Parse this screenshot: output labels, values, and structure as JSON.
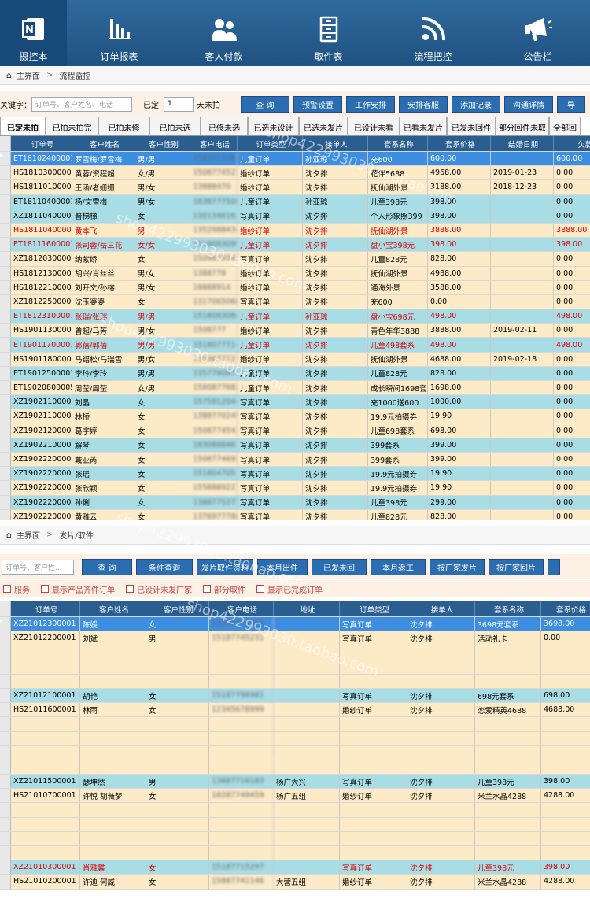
{
  "nav": [
    {
      "label": "摄控本",
      "icon": "onenote-icon"
    },
    {
      "label": "订单报表",
      "icon": "bar-chart-icon"
    },
    {
      "label": "客人付款",
      "icon": "users-icon"
    },
    {
      "label": "取件表",
      "icon": "cabinet-icon"
    },
    {
      "label": "流程把控",
      "icon": "signal-icon"
    },
    {
      "label": "公告栏",
      "icon": "megaphone-icon"
    }
  ],
  "bc1": {
    "home": "主界面",
    "sep": ">",
    "current": "流程监控"
  },
  "tb1": {
    "keyword_label": "关键字：",
    "keyword_placeholder": "订单号、客户姓名、电话",
    "fixed_label": "已定",
    "fixed_value": "1",
    "unshot_label": "天未拍",
    "buttons": [
      "查 询",
      "预警设置",
      "工作安排",
      "安排客服",
      "添加记录",
      "沟通详情",
      "导"
    ]
  },
  "tabs": [
    "已定未拍",
    "已拍未拍完",
    "已拍未修",
    "已拍未选",
    "已修未选",
    "已选未设计",
    "已选未发片",
    "已设计未看",
    "已看未发片",
    "已发未回件",
    "部分回件未取",
    "全部回"
  ],
  "grid1": {
    "headers": [
      "订单号",
      "客户姓名",
      "客户性别",
      "客户电话",
      "订单类型",
      "接单人",
      "套系名称",
      "套系价格",
      "结婚日期",
      "欠款"
    ],
    "rows": [
      {
        "s": "sel",
        "c": [
          "ET18102400001",
          "罗雪梅/罗雪梅",
          "男/男",
          "15825133821",
          "儿童订单",
          "孙亚琼",
          "充600",
          "600.00",
          "",
          "600.00"
        ]
      },
      {
        "s": "cream",
        "c": [
          "HS18103000001",
          "黄蓉/资程超",
          "女/男",
          "15087745231",
          "婚纱订单",
          "沈夕排",
          "花伴5688",
          "4968.00",
          "2019-01-23",
          "0.00"
        ]
      },
      {
        "s": "cream",
        "c": [
          "HS18110100001",
          "王函/者姗姗",
          "男/女",
          "13888470",
          "婚纱订单",
          "沈夕排",
          "抚仙湖外景",
          "3188.00",
          "2018-12-23",
          "0.00"
        ]
      },
      {
        "s": "blue",
        "c": [
          "ET18110400001",
          "杨/文雪梅",
          "男/女",
          "18387775080",
          "儿童订单",
          "孙亚琼",
          "儿童398元",
          "398.00",
          "",
          "0.00"
        ]
      },
      {
        "s": "blue",
        "c": [
          "XZ18110400002",
          "普梯梯",
          "女",
          "13013461636",
          "写真订单",
          "沈夕排",
          "个人形象照399",
          "398.00",
          "",
          "0.00"
        ]
      },
      {
        "s": "cream red",
        "c": [
          "HS18110400003",
          "黄本飞",
          "男",
          "13529884342",
          "婚纱订单",
          "沈夕排",
          "抚仙湖外景",
          "3888.00",
          "",
          "3888.00"
        ]
      },
      {
        "s": "blue red",
        "c": [
          "ET18111600001",
          "张司蓉/岳三花",
          "女/女",
          "15180830958",
          "儿童订单",
          "沈夕排",
          "盘小宝398元",
          "398.00",
          "",
          "398.00"
        ]
      },
      {
        "s": "cream",
        "c": [
          "XZ18120300001",
          "纳紫娇",
          "女",
          "15098765432",
          "写真订单",
          "沈夕排",
          "儿童828元",
          "828.00",
          "",
          "0.00"
        ]
      },
      {
        "s": "cream",
        "c": [
          "HS18121300001",
          "胡兴/肖丝丝",
          "男/女",
          "1388778",
          "婚纱订单",
          "沈夕排",
          "抚仙湖外景",
          "4988.00",
          "",
          "0.00"
        ]
      },
      {
        "s": "cream",
        "c": [
          "HS18122100001",
          "刘开文/孙榕",
          "男/女",
          "18888914",
          "婚纱订单",
          "沈夕排",
          "通海外景",
          "3588.00",
          "",
          "0.00"
        ]
      },
      {
        "s": "cream",
        "c": [
          "XZ18122500001",
          "沈玉婆婆",
          "女",
          "13170650686",
          "写真订单",
          "沈夕排",
          "充600",
          "0.00",
          "",
          "0.00"
        ]
      },
      {
        "s": "blue red",
        "c": [
          "ET18123100001",
          "张瑞/张瑞",
          "男/男",
          "15180830840",
          "儿童订单",
          "孙亚琼",
          "盘小宝698元",
          "498.00",
          "",
          "498.00"
        ]
      },
      {
        "s": "cream",
        "c": [
          "HS19011300001",
          "曾超/马芳",
          "男/女",
          "1508777",
          "婚纱订单",
          "沈夕排",
          "青色年华3888",
          "3888.00",
          "2019-02-11",
          "0.00"
        ]
      },
      {
        "s": "blue red",
        "c": [
          "ET19011700001",
          "郭蓓/郭蓓",
          "男/男",
          "15180777141",
          "儿童订单",
          "沈夕排",
          "儿童498套系",
          "498.00",
          "",
          "498.00"
        ]
      },
      {
        "s": "cream",
        "c": [
          "HS19011800001",
          "马绍松/马瑞雪",
          "男/女",
          "13508777214",
          "婚纱订单",
          "沈夕排",
          "抚仙湖外景",
          "4688.00",
          "2019-02-18",
          "0.00"
        ]
      },
      {
        "s": "blue",
        "c": [
          "ET19012500001",
          "李玲/李玲",
          "男/男",
          "13577809758",
          "儿童订单",
          "沈夕排",
          "儿童828元",
          "828.00",
          "",
          "0.00"
        ]
      },
      {
        "s": "cream",
        "c": [
          "ET19020800005",
          "周莹/周莹",
          "女/男",
          "15808776824",
          "儿童订单",
          "沈夕排",
          "成长瞬间1698套系",
          "1698.00",
          "",
          "0.00"
        ]
      },
      {
        "s": "blue",
        "c": [
          "XZ19021100001",
          "刘晶",
          "女",
          "15758120442",
          "写真订单",
          "沈夕排",
          "充1000送600",
          "1000.00",
          "",
          "0.00"
        ]
      },
      {
        "s": "cream",
        "c": [
          "XZ19021100002",
          "林桥",
          "女",
          "13887702496",
          "写真订单",
          "沈夕排",
          "19.9元拍摄券",
          "19.90",
          "",
          "0.00"
        ]
      },
      {
        "s": "cream",
        "c": [
          "XZ19021200001",
          "葛宇婷",
          "女",
          "15087745439",
          "写真订单",
          "沈夕排",
          "儿童698套系",
          "698.00",
          "",
          "0.00"
        ]
      },
      {
        "s": "blue",
        "c": [
          "XZ19022100001",
          "解琴",
          "女",
          "18308884615",
          "写真订单",
          "沈夕排",
          "399套系",
          "399.00",
          "",
          "0.00"
        ]
      },
      {
        "s": "cream",
        "c": [
          "XZ19022200001",
          "戴亚芮",
          "女",
          "15087746929",
          "写真订单",
          "沈夕排",
          "399套系",
          "399.00",
          "",
          "0.00"
        ]
      },
      {
        "s": "blue",
        "c": [
          "XZ19022200002",
          "张瑶",
          "女",
          "15180470539",
          "写真订单",
          "沈夕排",
          "19.9元拍摄券",
          "19.90",
          "",
          "0.00"
        ]
      },
      {
        "s": "cream",
        "c": [
          "XZ19022200003",
          "张欣颖",
          "女",
          "15588892279",
          "写真订单",
          "沈夕排",
          "19.9元拍摄券",
          "19.90",
          "",
          "0.00"
        ]
      },
      {
        "s": "blue",
        "c": [
          "XZ19022200004",
          "孙俐",
          "女",
          "13887753727",
          "写真订单",
          "沈夕排",
          "儿童398元",
          "299.00",
          "",
          "0.00"
        ]
      },
      {
        "s": "cream",
        "c": [
          "XZ19022200005",
          "黄雅云",
          "女",
          "13769777860",
          "写真订单",
          "沈夕排",
          "儿童828元",
          "828.00",
          "",
          "0.00"
        ]
      }
    ]
  },
  "bc2": {
    "home": "主界面",
    "sep": ">",
    "current": "发片/取件"
  },
  "tb2": {
    "placeholder": "订单号、客户姓...",
    "buttons": [
      "查 询",
      "条件查询",
      "发片取件资料",
      "本月出件",
      "已发未回",
      "本月返工",
      "按厂家发片",
      "按厂家回片",
      ""
    ]
  },
  "opts": [
    "服务",
    "显示产品齐件订单",
    "已设计未发厂家",
    "部分取件",
    "显示已完成订单"
  ],
  "grid2": {
    "headers": [
      "订单号",
      "客户姓名",
      "客户性别",
      "客户电话",
      "地址",
      "订单类型",
      "接单人",
      "套系名称",
      "套系价格"
    ],
    "rows": [
      {
        "s": "sel",
        "c": [
          "XZ21012300001",
          "陈媛",
          "女",
          "13345678903",
          "",
          "写真订单",
          "沈夕排",
          "3698元套系",
          "3698.00"
        ]
      },
      {
        "s": "cream",
        "c": [
          "XZ21012200001",
          "刘斌",
          "男",
          "15187745231",
          "",
          "写真订单",
          "沈夕排",
          "活动礼卡",
          "0.00"
        ]
      },
      {
        "s": "cream",
        "c": [
          "",
          "",
          "",
          "",
          "",
          "",
          "",
          "",
          ""
        ]
      },
      {
        "s": "cream",
        "c": [
          "",
          "",
          "",
          "",
          "",
          "",
          "",
          "",
          ""
        ]
      },
      {
        "s": "cream",
        "c": [
          "",
          "",
          "",
          "",
          "",
          "",
          "",
          "",
          ""
        ]
      },
      {
        "s": "blue",
        "c": [
          "XZ21012100001",
          "胡艳",
          "女",
          "15187798981",
          "",
          "写真订单",
          "沈夕排",
          "698元套系",
          "698.00"
        ]
      },
      {
        "s": "cream",
        "c": [
          "HS21011600001",
          "林雨",
          "女",
          "12345678999",
          "",
          "婚纱订单",
          "沈夕排",
          "恋爱精英4688",
          "4688.00"
        ]
      },
      {
        "s": "cream",
        "c": [
          "",
          "",
          "",
          "",
          "",
          "",
          "",
          "",
          ""
        ]
      },
      {
        "s": "cream",
        "c": [
          "",
          "",
          "",
          "",
          "",
          "",
          "",
          "",
          ""
        ]
      },
      {
        "s": "cream",
        "c": [
          "",
          "",
          "",
          "",
          "",
          "",
          "",
          "",
          ""
        ]
      },
      {
        "s": "cream",
        "c": [
          "",
          "",
          "",
          "",
          "",
          "",
          "",
          "",
          ""
        ]
      },
      {
        "s": "blue",
        "c": [
          "XZ21011500001",
          "瑟坤然",
          "男",
          "13887716183",
          "杨广大兴",
          "写真订单",
          "沈夕排",
          "儿童398元",
          "398.00"
        ]
      },
      {
        "s": "cream",
        "c": [
          "HS21010700001",
          "许悦  胡薇梦",
          "女",
          "18287749459",
          "杨广五组",
          "婚纱订单",
          "沈夕排",
          "米兰水晶4288",
          "4288.00"
        ]
      },
      {
        "s": "cream",
        "c": [
          "",
          "",
          "",
          "",
          "",
          "",
          "",
          "",
          ""
        ]
      },
      {
        "s": "cream",
        "c": [
          "",
          "",
          "",
          "",
          "",
          "",
          "",
          "",
          ""
        ]
      },
      {
        "s": "cream",
        "c": [
          "",
          "",
          "",
          "",
          "",
          "",
          "",
          "",
          ""
        ]
      },
      {
        "s": "cream",
        "c": [
          "",
          "",
          "",
          "",
          "",
          "",
          "",
          "",
          ""
        ]
      },
      {
        "s": "blue red",
        "c": [
          "XZ21010300001",
          "肖雅馨",
          "女",
          "15187715297",
          "",
          "写真订单",
          "沈夕排",
          "儿童398元",
          "398.00"
        ]
      },
      {
        "s": "cream",
        "c": [
          "HS21010200001",
          "许迪  何威",
          "女",
          "15887741146",
          "大营五组",
          "婚纱订单",
          "沈夕排",
          "米兰水晶4288",
          "4288.00"
        ]
      }
    ]
  },
  "watermark": "shop422993030.taobao.com"
}
